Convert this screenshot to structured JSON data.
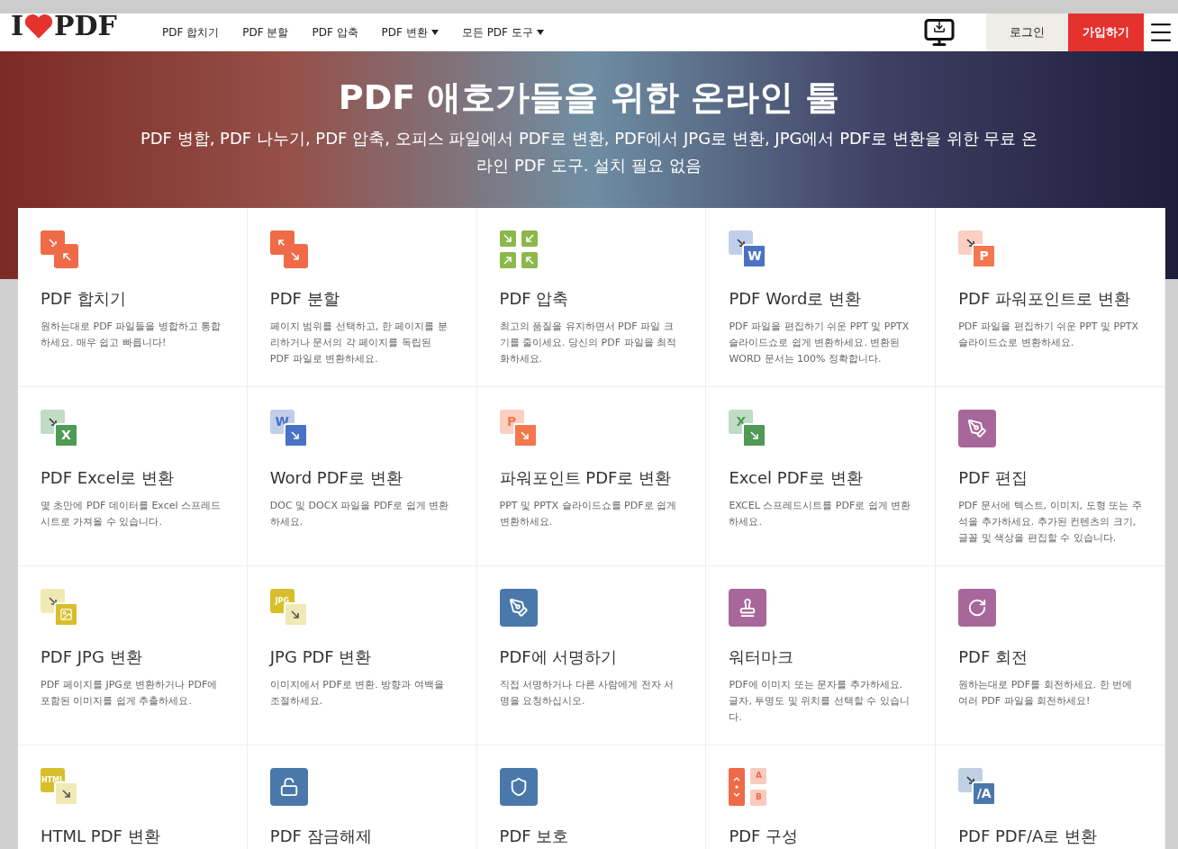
{
  "header": {
    "logo": {
      "left": "I",
      "right": "PDF"
    },
    "nav": [
      {
        "label": "PDF 합치기",
        "dropdown": false
      },
      {
        "label": "PDF 분할",
        "dropdown": false
      },
      {
        "label": "PDF 압축",
        "dropdown": false
      },
      {
        "label": "PDF 변환",
        "dropdown": true
      },
      {
        "label": "모든 PDF 도구",
        "dropdown": true
      }
    ],
    "login": "로그인",
    "signup": "가입하기"
  },
  "hero": {
    "title": "PDF 애호가들을 위한 온라인 툴",
    "subtitle": "PDF 병합, PDF 나누기, PDF 압축, 오피스 파일에서 PDF로 변환, PDF에서 JPG로 변환, JPG에서 PDF로 변환을 위한 무료 온라인 PDF 도구. 설치 필요 없음"
  },
  "tools": [
    {
      "title": "PDF 합치기",
      "description": "원하는대로 PDF 파일들을 병합하고 통합하세요. 매우 쉽고 빠릅니다!",
      "icon": {
        "kind": "merge",
        "color": "#ef6a47"
      }
    },
    {
      "title": "PDF 분할",
      "description": "페이지 범위를 선택하고, 한 페이지를 분리하거나 문서의 각 페이지를 독립된 PDF 파일로 변환하세요.",
      "icon": {
        "kind": "split",
        "color": "#ef6a47"
      }
    },
    {
      "title": "PDF 압축",
      "description": "최고의 품질을 유지하면서 PDF 파일 크기를 줄이세요. 당신의 PDF 파일을 최적화하세요.",
      "icon": {
        "kind": "quad",
        "color": "#8bb84a"
      }
    },
    {
      "title": "PDF Word로 변환",
      "description": "PDF 파일을 편집하기 쉬운 PPT 및 PPTX 슬라이드쇼로 쉽게 변환하세요. 변환된 WORD 문서는 100% 정확합니다.",
      "icon": {
        "kind": "front_letter",
        "color": "#4a72c4",
        "label": "W"
      }
    },
    {
      "title": "PDF 파워포인트로 변환",
      "description": "PDF 파일을 편집하기 쉬운 PPT 및 PPTX 슬라이드쇼로 변환하세요.",
      "icon": {
        "kind": "front_letter",
        "color": "#f4774f",
        "label": "P"
      }
    },
    {
      "title": "PDF Excel로 변환",
      "description": "몇 초만에 PDF 데이터를 Excel 스프레드시트로 가져올 수 있습니다.",
      "icon": {
        "kind": "front_letter",
        "color": "#4f9a55",
        "label": "X"
      }
    },
    {
      "title": "Word PDF로 변환",
      "description": "DOC 및 DOCX 파일을 PDF로 쉽게 변환하세요.",
      "icon": {
        "kind": "back_letter",
        "color": "#4a72c4",
        "label": "W"
      }
    },
    {
      "title": "파워포인트 PDF로 변환",
      "description": "PPT 및 PPTX 슬라이드쇼를 PDF로 쉽게 변환하세요.",
      "icon": {
        "kind": "back_letter",
        "color": "#f4774f",
        "label": "P"
      }
    },
    {
      "title": "Excel PDF로 변환",
      "description": "EXCEL 스프레드시트를 PDF로 쉽게 변환하세요.",
      "icon": {
        "kind": "back_letter",
        "color": "#4f9a55",
        "label": "X"
      }
    },
    {
      "title": "PDF 편집",
      "description": "PDF 문서에 텍스트, 이미지, 도형 또는 주석을 추가하세요. 추가된 컨텐츠의 크기, 글꼴 및 색상을 편집할 수 있습니다.",
      "icon": {
        "kind": "edit",
        "color": "#a8679a"
      }
    },
    {
      "title": "PDF JPG 변환",
      "description": "PDF 페이지를 JPG로 변환하거나 PDF에 포함된 이미지를 쉽게 추출하세요.",
      "icon": {
        "kind": "image",
        "color": "#d8bf2a"
      }
    },
    {
      "title": "JPG PDF 변환",
      "description": "이미지에서 PDF로 변환. 방향과 여백을 조절하세요.",
      "icon": {
        "kind": "back_tag",
        "color": "#d8bf2a",
        "label": "JPG"
      }
    },
    {
      "title": "PDF에 서명하기",
      "description": "직접 서명하거나 다른 사람에게 전자 서명을 요청하십시오.",
      "icon": {
        "kind": "sign",
        "color": "#4a78ab"
      }
    },
    {
      "title": "워터마크",
      "description": "PDF에 이미지 또는 문자를 추가하세요. 글자, 투명도 및 위치를 선택할 수 있습니다.",
      "icon": {
        "kind": "stamp",
        "color": "#a8679a"
      }
    },
    {
      "title": "PDF 회전",
      "description": "원하는대로 PDF를 회전하세요. 한 번에 여러 PDF 파일을 회전하세요!",
      "icon": {
        "kind": "rotate",
        "color": "#a8679a"
      }
    },
    {
      "title": "HTML PDF 변환",
      "icon": {
        "kind": "back_tag",
        "color": "#d8bf2a",
        "label": "HTML"
      }
    },
    {
      "title": "PDF 잠금해제",
      "icon": {
        "kind": "unlock",
        "color": "#4a78ab"
      }
    },
    {
      "title": "PDF 보호",
      "icon": {
        "kind": "protect",
        "color": "#4a78ab"
      }
    },
    {
      "title": "PDF 구성",
      "icon": {
        "kind": "organize",
        "color": "#ef6a47",
        "labels": [
          "A",
          "B"
        ]
      }
    },
    {
      "title": "PDF PDF/A로 변환",
      "icon": {
        "kind": "front_letter",
        "color": "#4a78ab",
        "label": "/A"
      }
    }
  ]
}
